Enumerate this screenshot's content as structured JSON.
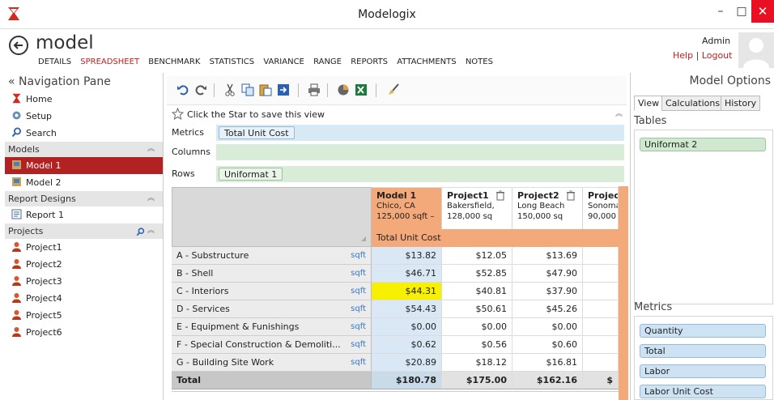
{
  "window": {
    "title": "Modelogix",
    "minimize": "–",
    "maximize": "□",
    "close": "✕"
  },
  "header": {
    "model_title": "model",
    "tabs": [
      {
        "label": "DETAILS",
        "active": false
      },
      {
        "label": "SPREADSHEET",
        "active": true
      },
      {
        "label": "BENCHMARK",
        "active": false
      },
      {
        "label": "STATISTICS",
        "active": false
      },
      {
        "label": "VARIANCE",
        "active": false
      },
      {
        "label": "RANGE",
        "active": false
      },
      {
        "label": "REPORTS",
        "active": false
      },
      {
        "label": "ATTACHMENTS",
        "active": false
      },
      {
        "label": "NOTES",
        "active": false
      }
    ],
    "user": "Admin",
    "help": "Help",
    "separator": "|",
    "logout": "Logout"
  },
  "nav": {
    "title": "« Navigation Pane",
    "top_items": [
      "Home",
      "Setup",
      "Search"
    ],
    "models_header": "Models",
    "models": [
      {
        "label": "Model 1",
        "selected": true
      },
      {
        "label": "Model 2",
        "selected": false
      }
    ],
    "reports_header": "Report Designs",
    "reports": [
      "Report 1"
    ],
    "projects_header": "Projects",
    "projects": [
      "Project1",
      "Project2",
      "Project3",
      "Project4",
      "Project5",
      "Project6"
    ]
  },
  "center": {
    "star_text": "Click the Star to save this view",
    "metrics_label": "Metrics",
    "metrics_chip": "Total Unit Cost",
    "columns_label": "Columns",
    "rows_label": "Rows",
    "rows_chip": "Uniformat 1"
  },
  "grid": {
    "metric_band": "Total Unit Cost",
    "columns": [
      {
        "name": "Model 1",
        "line1": "Chico, CA",
        "line2": "125,000 sqft –"
      },
      {
        "name": "Project1",
        "line1": "Bakersfield,",
        "line2": "128,000 sq"
      },
      {
        "name": "Project2",
        "line1": "Long Beach",
        "line2": "150,000 sq"
      },
      {
        "name": "Project",
        "line1": "Sonoma",
        "line2": "90,000"
      }
    ],
    "rows": [
      {
        "label": "A - Substructure",
        "unit": "sqft",
        "values": [
          "$13.82",
          "$12.05",
          "$13.69",
          ""
        ]
      },
      {
        "label": "B - Shell",
        "unit": "sqft",
        "values": [
          "$46.71",
          "$52.85",
          "$47.90",
          ""
        ]
      },
      {
        "label": "C - Interiors",
        "unit": "sqft",
        "values": [
          "$44.31",
          "$40.81",
          "$37.90",
          ""
        ],
        "highlight": true
      },
      {
        "label": "D - Services",
        "unit": "sqft",
        "values": [
          "$54.43",
          "$50.61",
          "$45.26",
          ""
        ]
      },
      {
        "label": "E - Equipment & Funishings",
        "unit": "sqft",
        "values": [
          "$0.00",
          "$0.00",
          "$0.00",
          ""
        ]
      },
      {
        "label": "F - Special Construction & Demoliti...",
        "unit": "sqft",
        "values": [
          "$0.62",
          "$0.56",
          "$0.60",
          ""
        ]
      },
      {
        "label": "G - Building Site Work",
        "unit": "sqft",
        "values": [
          "$20.89",
          "$18.12",
          "$16.81",
          ""
        ]
      }
    ],
    "total": {
      "label": "Total",
      "values": [
        "$180.78",
        "$175.00",
        "$162.16",
        "$"
      ]
    }
  },
  "options": {
    "title": "Model Options",
    "tabs": [
      {
        "label": "View",
        "active": true
      },
      {
        "label": "Calculations",
        "active": false
      },
      {
        "label": "History",
        "active": false
      }
    ],
    "tables_header": "Tables",
    "tables": [
      "Uniformat 2"
    ],
    "metrics_header": "Metrics",
    "metrics": [
      "Quantity",
      "Total",
      "Labor",
      "Labor Unit Cost"
    ]
  },
  "colors": {
    "accent": "#b22222",
    "brand_red": "#c0201e",
    "header_orange": "#f4a97a",
    "highlight": "#f7f000"
  }
}
